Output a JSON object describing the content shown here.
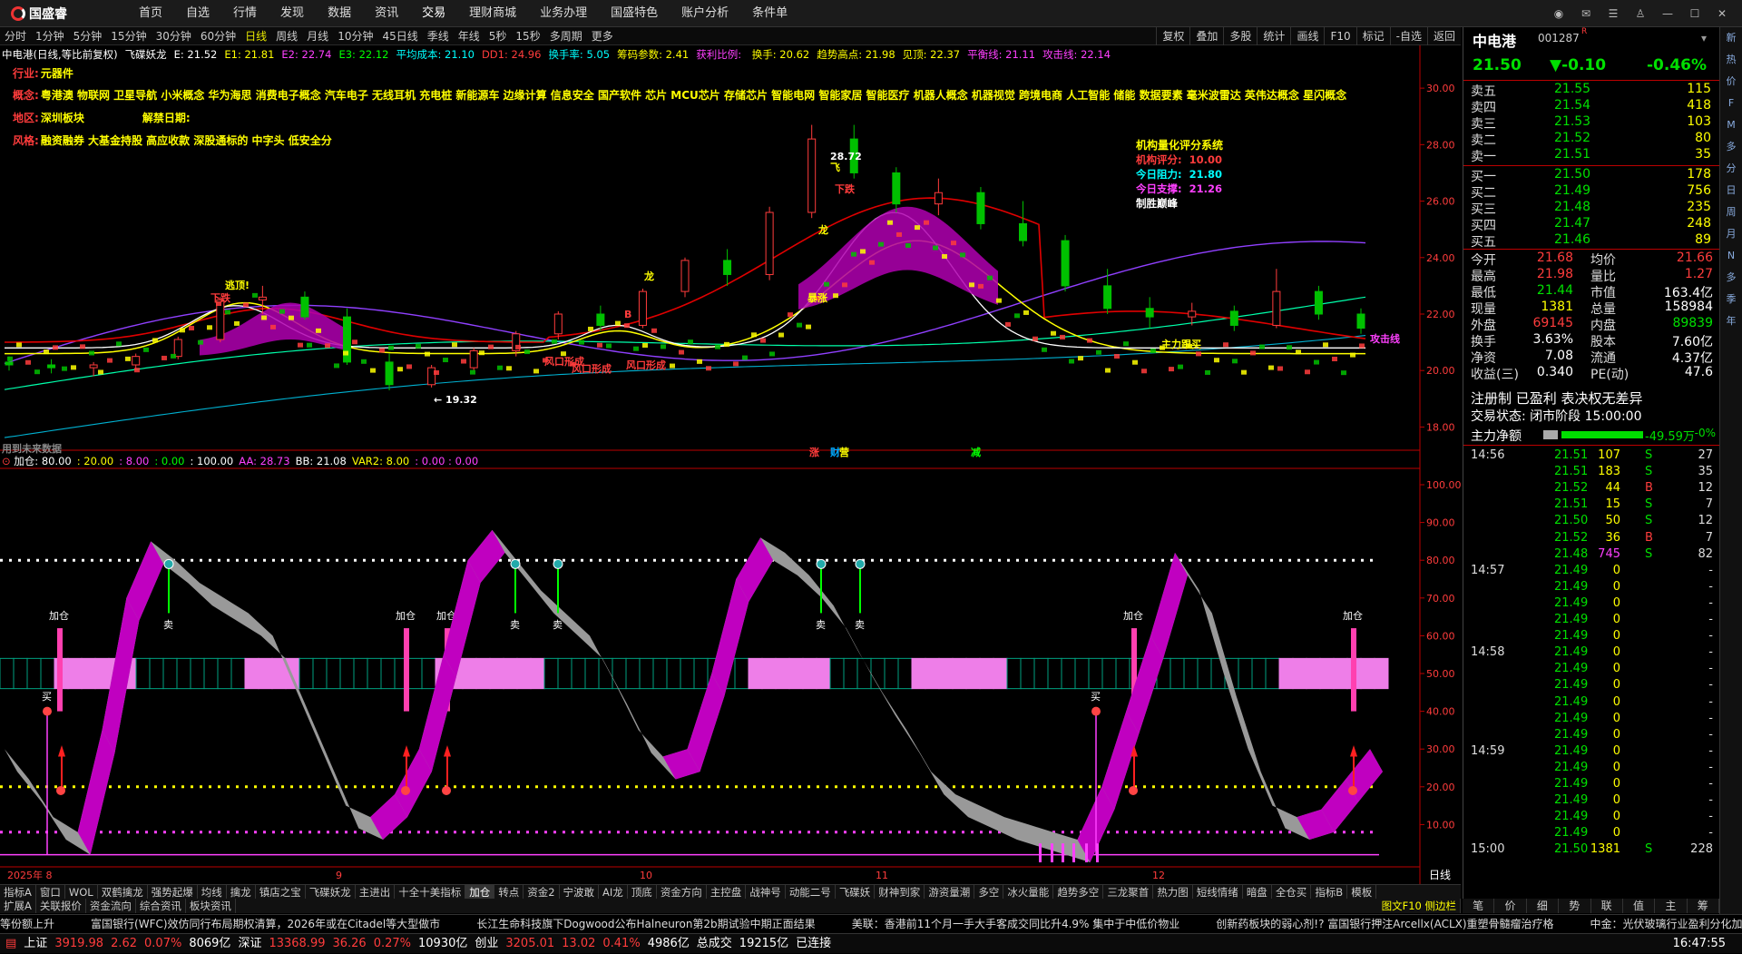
{
  "app": {
    "logo": "国盛睿",
    "menu": [
      "首页",
      "自选",
      "行情",
      "发现",
      "数据",
      "资讯",
      "交易",
      "理财商城",
      "业务办理",
      "国盛特色",
      "账户分析",
      "条件单"
    ],
    "window_buttons": [
      "speech-icon",
      "mail-icon",
      "list-icon",
      "shirt-icon",
      "min-icon",
      "max-icon",
      "close-icon"
    ]
  },
  "toolbar": {
    "periods": [
      "分时",
      "1分钟",
      "5分钟",
      "15分钟",
      "30分钟",
      "60分钟",
      "日线",
      "周线",
      "月线",
      "10分钟",
      "45日线",
      "季线",
      "年线",
      "5秒",
      "15秒",
      "多周期",
      "更多"
    ],
    "active_period": "日线",
    "right": [
      "复权",
      "叠加",
      "多股",
      "统计",
      "画线",
      "F10",
      "标记",
      "-自选",
      "返回"
    ]
  },
  "main_chart": {
    "indicator_line": [
      {
        "t": "中电港(日线,等比前复权)",
        "c": "#ffffff"
      },
      {
        "t": "飞碟妖龙",
        "c": "#ffffff"
      },
      {
        "t": "E: 21.52",
        "c": "#ffffff"
      },
      {
        "t": "E1: 21.81",
        "c": "#ffff00"
      },
      {
        "t": "E2: 22.74",
        "c": "#ff40ff"
      },
      {
        "t": "E3: 22.12",
        "c": "#00ff00"
      },
      {
        "t": "平均成本: 21.10",
        "c": "#00ffff"
      },
      {
        "t": "DD1: 24.96",
        "c": "#ff3c3c"
      },
      {
        "t": "换手率: 5.05",
        "c": "#00ffff"
      },
      {
        "t": "筹码参数: 2.41",
        "c": "#ffff00"
      },
      {
        "t": "获利比例: ",
        "c": "#ff40ff"
      },
      {
        "t": "换手: 20.62",
        "c": "#ffff00"
      },
      {
        "t": "趋势高点: 21.98",
        "c": "#ffff00"
      },
      {
        "t": "见顶: 22.37",
        "c": "#ffff00"
      },
      {
        "t": "平衡线: 21.11",
        "c": "#ff40ff"
      },
      {
        "t": "攻击线: 22.14",
        "c": "#ff40ff"
      }
    ],
    "info_lines": [
      {
        "label": "行业:",
        "text": "元器件"
      },
      {
        "label": "概念:",
        "text": "粤港澳 物联网 卫星导航 小米概念 华为海思 消费电子概念 汽车电子 无线耳机 充电桩 新能源车 边缘计算 信息安全 国产软件 芯片 MCU芯片 存储芯片 智能电网 智能家居 智能医疗 机器人概念 机器视觉 跨境电商 人工智能 储能 数据要素 毫米波雷达 英伟达概念 星闪概念"
      },
      {
        "label": "地区:",
        "text": "深圳板块",
        "extra": "解禁日期:"
      },
      {
        "label": "风格:",
        "text": "融资融券 大基金持股 高应收款 深股通标的 中字头 低安全分"
      }
    ],
    "score_box": {
      "title": "机构量化评分系统",
      "lines": [
        {
          "label": "机构评分:",
          "value": "10.00",
          "color": "#ff3c3c"
        },
        {
          "label": "今日阻力:",
          "value": "21.80",
          "color": "#00ffff"
        },
        {
          "label": "今日支撑:",
          "value": "21.26",
          "color": "#ff40ff"
        },
        {
          "label": "制胜巅峰",
          "value": "",
          "color": "#ffffff"
        }
      ]
    },
    "price_axis": [
      "30.00",
      "28.00",
      "26.00",
      "24.00",
      "22.00",
      "20.00",
      "18.00"
    ],
    "annotations": [
      {
        "t": "逃顶!",
        "c": "#ffff00"
      },
      {
        "t": "下跌",
        "c": "#ff3c3c"
      },
      {
        "t": "下跌",
        "c": "#ff3c3c"
      },
      {
        "t": "← 19.32",
        "c": "#ffffff"
      },
      {
        "t": "风口形成",
        "c": "#ff3c3c"
      },
      {
        "t": "风口形成",
        "c": "#ff3c3c"
      },
      {
        "t": "风口形成",
        "c": "#ff3c3c"
      },
      {
        "t": "龙",
        "c": "#ffff00"
      },
      {
        "t": "B",
        "c": "#ff3c3c"
      },
      {
        "t": "飞",
        "c": "#ffff00"
      },
      {
        "t": "28.72",
        "c": "#ffffff"
      },
      {
        "t": "暴涨",
        "c": "#ffff00"
      },
      {
        "t": "龙",
        "c": "#ffff00"
      },
      {
        "t": "主力跟买",
        "c": "#ffff00"
      },
      {
        "t": "攻击线",
        "c": "#ff40ff"
      },
      {
        "t": "用到未来数据",
        "c": "#888888"
      },
      {
        "t": "涨",
        "c": "#ff3c3c"
      },
      {
        "t": "营",
        "c": "#ffff00"
      },
      {
        "t": "财",
        "c": "#00aaff"
      },
      {
        "t": "减",
        "c": "#00ff00"
      }
    ],
    "chart_data": {
      "type": "candlestick",
      "ylim": [
        17.5,
        31.0
      ],
      "last_close": 21.5,
      "ohlc_sample": [
        [
          20.3,
          20.5,
          20.0,
          20.2
        ],
        [
          20.2,
          20.4,
          19.9,
          20.1
        ],
        [
          20.1,
          20.3,
          19.8,
          20.2
        ],
        [
          20.2,
          20.6,
          20.0,
          20.5
        ],
        [
          20.5,
          21.2,
          20.4,
          21.1
        ],
        [
          21.1,
          22.6,
          21.0,
          22.5
        ],
        [
          22.5,
          23.0,
          22.0,
          22.6
        ],
        [
          22.6,
          22.8,
          21.8,
          21.9
        ],
        [
          21.9,
          22.2,
          20.2,
          20.3
        ],
        [
          20.3,
          20.6,
          19.3,
          19.5
        ],
        [
          19.5,
          20.2,
          19.4,
          20.1
        ],
        [
          20.1,
          20.8,
          20.0,
          20.7
        ],
        [
          20.7,
          21.4,
          20.5,
          21.3
        ],
        [
          21.3,
          22.1,
          21.1,
          22.0
        ],
        [
          22.0,
          22.3,
          21.4,
          21.6
        ],
        [
          21.6,
          22.9,
          21.5,
          22.8
        ],
        [
          22.8,
          24.0,
          22.6,
          23.9
        ],
        [
          23.9,
          24.3,
          23.0,
          23.4
        ],
        [
          23.4,
          25.8,
          23.2,
          25.6
        ],
        [
          25.6,
          28.7,
          25.4,
          28.2
        ],
        [
          28.2,
          28.7,
          26.8,
          27.0
        ],
        [
          27.0,
          27.2,
          25.6,
          25.9
        ],
        [
          25.9,
          26.8,
          25.5,
          26.3
        ],
        [
          26.3,
          26.5,
          25.0,
          25.2
        ],
        [
          25.2,
          26.0,
          24.4,
          24.6
        ],
        [
          24.6,
          24.8,
          22.8,
          23.0
        ],
        [
          23.0,
          23.6,
          22.0,
          22.2
        ],
        [
          22.2,
          22.6,
          21.5,
          21.9
        ],
        [
          21.9,
          22.4,
          21.6,
          22.1
        ],
        [
          22.1,
          22.3,
          21.4,
          21.6
        ],
        [
          21.6,
          23.6,
          21.5,
          22.8
        ],
        [
          22.8,
          23.0,
          21.8,
          22.0
        ],
        [
          22.0,
          22.2,
          21.3,
          21.5
        ]
      ]
    }
  },
  "sub_chart": {
    "indicator_line": [
      {
        "t": "加仓: 80.00",
        "c": "#ffffff"
      },
      {
        "t": ": 20.00",
        "c": "#ffff00"
      },
      {
        "t": ": 8.00",
        "c": "#ff40ff"
      },
      {
        "t": ": 0.00",
        "c": "#00ff00"
      },
      {
        "t": ": 100.00",
        "c": "#ffffff"
      },
      {
        "t": "AA: 28.73",
        "c": "#ff40ff"
      },
      {
        "t": "BB: 21.08",
        "c": "#ffffff"
      },
      {
        "t": "VAR2: 8.00",
        "c": "#ffff00"
      },
      {
        "t": ": 0.00 : 0.00",
        "c": "#ff40ff"
      }
    ],
    "axis": [
      "100.00",
      "90.00",
      "80.00",
      "70.00",
      "60.00",
      "50.00",
      "40.00",
      "30.00",
      "20.00",
      "10.00"
    ],
    "labels": {
      "add": "加仓",
      "sell": "卖",
      "buy": "买"
    },
    "chart_data": {
      "type": "line",
      "ylim": [
        0,
        100
      ],
      "series": [
        {
          "values": [
            30,
            22,
            12,
            8,
            35,
            70,
            85,
            80,
            74,
            70,
            66,
            60,
            45,
            30,
            15,
            12,
            18,
            30,
            55,
            80,
            88,
            80,
            72,
            66,
            60,
            48,
            35,
            28,
            30,
            50,
            75,
            86,
            82,
            76,
            68,
            56,
            45,
            35,
            24,
            18,
            15,
            12,
            10,
            8,
            6,
            20,
            40,
            60,
            82,
            72,
            50,
            30,
            15,
            12,
            14,
            22,
            30
          ]
        }
      ]
    },
    "date_labels": [
      "2025年 8",
      "9",
      "10",
      "11",
      "12"
    ],
    "period_label": "日线"
  },
  "quote": {
    "name": "中电港",
    "code": "001287",
    "price": "21.50",
    "change": "▼-0.10",
    "pct": "-0.46%",
    "asks": [
      {
        "l": "卖五",
        "p": "21.55",
        "v": "115"
      },
      {
        "l": "卖四",
        "p": "21.54",
        "v": "418"
      },
      {
        "l": "卖三",
        "p": "21.53",
        "v": "103"
      },
      {
        "l": "卖二",
        "p": "21.52",
        "v": "80"
      },
      {
        "l": "卖一",
        "p": "21.51",
        "v": "35"
      }
    ],
    "bids": [
      {
        "l": "买一",
        "p": "21.50",
        "v": "178"
      },
      {
        "l": "买二",
        "p": "21.49",
        "v": "756"
      },
      {
        "l": "买三",
        "p": "21.48",
        "v": "235"
      },
      {
        "l": "买四",
        "p": "21.47",
        "v": "248"
      },
      {
        "l": "买五",
        "p": "21.46",
        "v": "89"
      }
    ],
    "stats": [
      {
        "l1": "今开",
        "v1": "21.68",
        "c1": "#ff3c3c",
        "l2": "均价",
        "v2": "21.66",
        "c2": "#ff3c3c"
      },
      {
        "l1": "最高",
        "v1": "21.98",
        "c1": "#ff3c3c",
        "l2": "量比",
        "v2": "1.27",
        "c2": "#ff3c3c"
      },
      {
        "l1": "最低",
        "v1": "21.44",
        "c1": "#00e000",
        "l2": "市值",
        "v2": "163.4亿",
        "c2": "#ffffff"
      },
      {
        "l1": "现量",
        "v1": "1381",
        "c1": "#ffff00",
        "l2": "总量",
        "v2": "158984",
        "c2": "#ffffff"
      },
      {
        "l1": "外盘",
        "v1": "69145",
        "c1": "#ff3c3c",
        "l2": "内盘",
        "v2": "89839",
        "c2": "#00e000"
      },
      {
        "l1": "换手",
        "v1": "3.63%",
        "c1": "#ffffff",
        "l2": "股本",
        "v2": "7.60亿",
        "c2": "#ffffff"
      },
      {
        "l1": "净资",
        "v1": "7.08",
        "c1": "#ffffff",
        "l2": "流通",
        "v2": "4.37亿",
        "c2": "#ffffff"
      },
      {
        "l1": "收益(三)",
        "v1": "0.340",
        "c1": "#ffffff",
        "l2": "PE(动)",
        "v2": "47.6",
        "c2": "#ffffff"
      }
    ],
    "reg_line": "注册制 已盈利 表决权无差异",
    "trade_state": "交易状态: 闭市阶段 15:00:00",
    "main_flow_label": "主力净额",
    "main_flow_value": "-49.59万",
    "main_flow_pct": "-0%",
    "ticks": [
      {
        "t": "14:56",
        "p": "21.51",
        "v": "107",
        "s": "S",
        "n": "27"
      },
      {
        "t": "",
        "p": "21.51",
        "v": "183",
        "s": "S",
        "n": "35"
      },
      {
        "t": "",
        "p": "21.52",
        "v": "44",
        "s": "B",
        "n": "12"
      },
      {
        "t": "",
        "p": "21.51",
        "v": "15",
        "s": "S",
        "n": "7"
      },
      {
        "t": "",
        "p": "21.50",
        "v": "50",
        "s": "S",
        "n": "12"
      },
      {
        "t": "",
        "p": "21.52",
        "v": "36",
        "s": "B",
        "n": "7"
      },
      {
        "t": "",
        "p": "21.48",
        "v": "745",
        "s": "S",
        "n": "82"
      },
      {
        "t": "14:57",
        "p": "21.49",
        "v": "0",
        "s": "",
        "n": "-"
      },
      {
        "t": "",
        "p": "21.49",
        "v": "0",
        "s": "",
        "n": "-"
      },
      {
        "t": "",
        "p": "21.49",
        "v": "0",
        "s": "",
        "n": "-"
      },
      {
        "t": "",
        "p": "21.49",
        "v": "0",
        "s": "",
        "n": "-"
      },
      {
        "t": "",
        "p": "21.49",
        "v": "0",
        "s": "",
        "n": "-"
      },
      {
        "t": "14:58",
        "p": "21.49",
        "v": "0",
        "s": "",
        "n": "-"
      },
      {
        "t": "",
        "p": "21.49",
        "v": "0",
        "s": "",
        "n": "-"
      },
      {
        "t": "",
        "p": "21.49",
        "v": "0",
        "s": "",
        "n": "-"
      },
      {
        "t": "",
        "p": "21.49",
        "v": "0",
        "s": "",
        "n": "-"
      },
      {
        "t": "",
        "p": "21.49",
        "v": "0",
        "s": "",
        "n": "-"
      },
      {
        "t": "",
        "p": "21.49",
        "v": "0",
        "s": "",
        "n": "-"
      },
      {
        "t": "14:59",
        "p": "21.49",
        "v": "0",
        "s": "",
        "n": "-"
      },
      {
        "t": "",
        "p": "21.49",
        "v": "0",
        "s": "",
        "n": "-"
      },
      {
        "t": "",
        "p": "21.49",
        "v": "0",
        "s": "",
        "n": "-"
      },
      {
        "t": "",
        "p": "21.49",
        "v": "0",
        "s": "",
        "n": "-"
      },
      {
        "t": "",
        "p": "21.49",
        "v": "0",
        "s": "",
        "n": "-"
      },
      {
        "t": "",
        "p": "21.49",
        "v": "0",
        "s": "",
        "n": "-"
      },
      {
        "t": "15:00",
        "p": "21.50",
        "v": "1381",
        "s": "S",
        "n": "228"
      }
    ]
  },
  "side_icons": [
    "新",
    "热",
    "价",
    "F",
    "M",
    "多",
    "分",
    "日",
    "周",
    "月",
    "N",
    "多",
    "季",
    "年"
  ],
  "bottom_tabs": [
    "指标A",
    "窗口",
    "WOL",
    "双鹤擒龙",
    "强势起爆",
    "均线",
    "擒龙",
    "镇店之宝",
    "飞碟妖龙",
    "主进出",
    "十全十美指标",
    "加仓",
    "转点",
    "资金2",
    "宁波敢",
    "AI龙",
    "顶底",
    "资金方向",
    "主控盘",
    "战神号",
    "动能二号",
    "飞碟妖",
    "财神到家",
    "游资量潮",
    "多空",
    "冰火量能",
    "趋势多空",
    "三龙聚首",
    "热力图",
    "短线情绪",
    "暗盘",
    "全仓买",
    "指标B",
    "模板"
  ],
  "bottom_tabs_active": "加仓",
  "bottom_tabs2": [
    "扩展A",
    "关联报价",
    "资金流向",
    "综合资讯",
    "板块资讯"
  ],
  "bottom_tabs2_right": "图文F10 侧边栏",
  "right_tabs": [
    "笔",
    "价",
    "细",
    "势",
    "联",
    "值",
    "主",
    "筹"
  ],
  "news": [
    "等份额上升",
    "富国银行(WFC)效仿同行布局期权清算，2026年或在Citadel等大型做市",
    "长江生命科技旗下Dogwood公布Halneuron第2b期试验中期正面结果",
    "美联：香港前11个月一手大手客成交同比升4.9% 集中于中低价物业",
    "创新药板块的弱心剂!? 富国银行押注Arcellx(ACLX)重塑骨髓瘤治疗格",
    "中金：光伏玻璃行业盈利分化加大"
  ],
  "status": {
    "sh_label": "上证",
    "sh": "3919.98",
    "sh_chg": "2.62",
    "sh_pct": "0.07%",
    "sh_amt": "8069亿",
    "sz_label": "深证",
    "sz": "13368.99",
    "sz_chg": "36.26",
    "sz_pct": "0.27%",
    "sz_amt": "10930亿",
    "cy_label": "创业",
    "cy": "3205.01",
    "cy_chg": "13.02",
    "cy_pct": "0.41%",
    "cy_amt": "4986亿",
    "total_label": "总成交",
    "total": "19215亿",
    "conn": "已连接",
    "time": "16:47:55"
  }
}
